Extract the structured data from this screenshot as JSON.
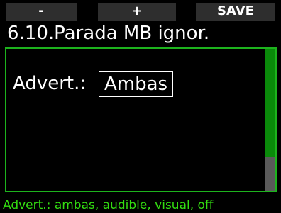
{
  "softkeys": {
    "left_label": "-",
    "middle_label": "+",
    "right_label": "SAVE"
  },
  "header": {
    "title": "6.10.Parada MB ignor."
  },
  "setting": {
    "label": "Advert.:",
    "value": "Ambas"
  },
  "scroll": {
    "position_fraction": 0.76
  },
  "help": {
    "text": "Advert.: ambas, audible, visual, off"
  },
  "colors": {
    "background": "#000000",
    "accent_green": "#1db31d",
    "help_text_green": "#33dd11",
    "softkey_bg": "#2e2e2e"
  }
}
